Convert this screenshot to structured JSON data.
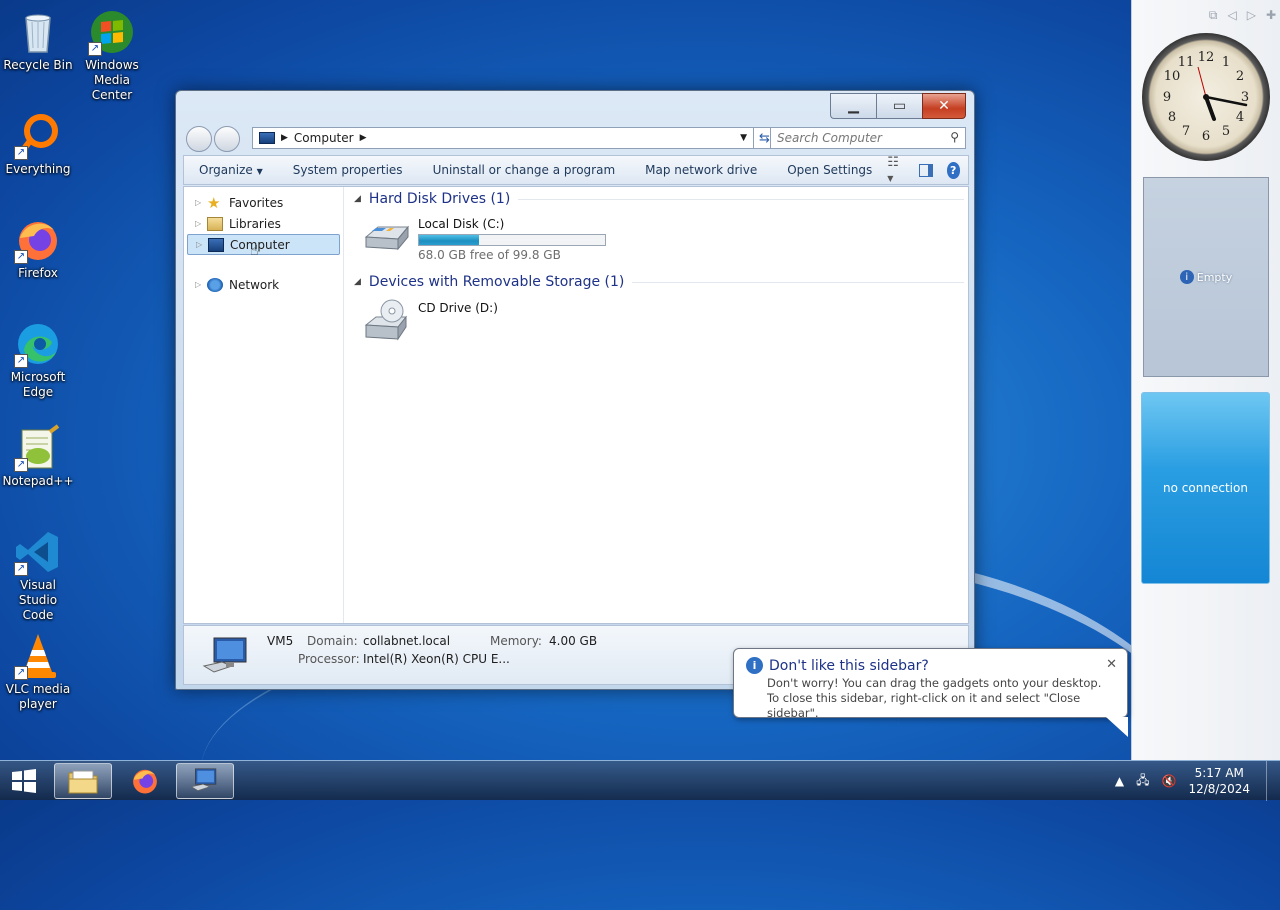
{
  "desktop": {
    "icons": [
      {
        "label": "Recycle Bin",
        "icon": "recycle-bin-icon"
      },
      {
        "label": "Windows\nMedia Center",
        "icon": "windows-media-center-icon"
      },
      {
        "label": "Everything",
        "icon": "everything-icon"
      },
      {
        "label": "Firefox",
        "icon": "firefox-icon"
      },
      {
        "label": "Microsoft\nEdge",
        "icon": "edge-icon"
      },
      {
        "label": "Notepad++",
        "icon": "notepadpp-icon"
      },
      {
        "label": "Visual Studio\nCode",
        "icon": "vscode-icon"
      },
      {
        "label": "VLC media\nplayer",
        "icon": "vlc-icon"
      }
    ]
  },
  "explorer": {
    "address": {
      "path": "Computer"
    },
    "search": {
      "placeholder": "Search Computer"
    },
    "toolbar": {
      "organize": "Organize",
      "system_properties": "System properties",
      "uninstall": "Uninstall or change a program",
      "map_drive": "Map network drive",
      "open_settings": "Open Settings"
    },
    "nav": {
      "favorites": "Favorites",
      "libraries": "Libraries",
      "computer": "Computer",
      "network": "Network"
    },
    "groups": {
      "hdd": {
        "title": "Hard Disk Drives (1)"
      },
      "removable": {
        "title": "Devices with Removable Storage (1)"
      }
    },
    "drives": {
      "c": {
        "name": "Local Disk (C:)",
        "free": "68.0 GB free of 99.8 GB",
        "used_fraction": 0.32
      },
      "d": {
        "name": "CD Drive (D:)"
      }
    },
    "details": {
      "name": "VM5",
      "domain_label": "Domain:",
      "domain_value": "collabnet.local",
      "memory_label": "Memory:",
      "memory_value": "4.00 GB",
      "processor_label": "Processor:",
      "processor_value": "Intel(R) Xeon(R) CPU E..."
    }
  },
  "sidebar": {
    "gadget_empty": "Empty",
    "gadget_weather": "no connection"
  },
  "balloon": {
    "title": "Don't like this sidebar?",
    "text": "Don't worry! You can drag the gadgets onto your desktop. To close this sidebar, right-click on it and select \"Close sidebar\"."
  },
  "taskbar": {
    "time": "5:17 AM",
    "date": "12/8/2024"
  },
  "colors": {
    "desktop": "#1565c0",
    "selection": "#cce4f7",
    "group_heading": "#1e3287",
    "disk_fill": "#1d8fc0"
  }
}
